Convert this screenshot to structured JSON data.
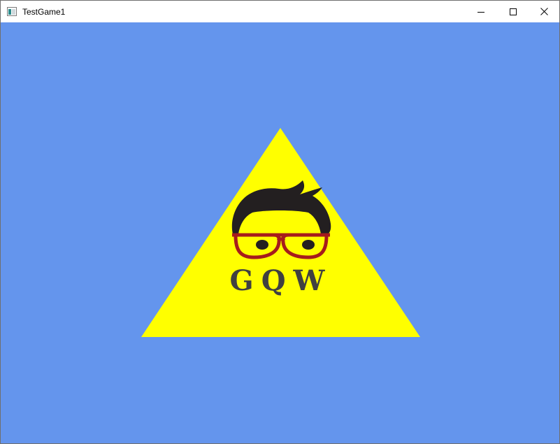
{
  "window": {
    "title": "TestGame1",
    "buttons": {
      "minimize": "minimize-icon",
      "maximize": "maximize-icon",
      "close": "close-icon"
    }
  },
  "scene": {
    "background_color": "#6495ED",
    "triangle_color": "#FFFF00",
    "logo": {
      "text": "GQW",
      "text_color": "#404040",
      "hair_color": "#231F20",
      "glasses_color": "#A61C1C"
    }
  }
}
